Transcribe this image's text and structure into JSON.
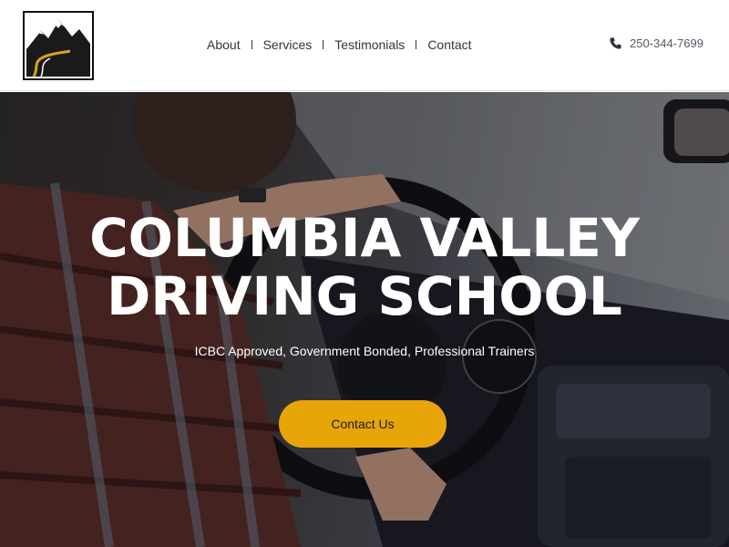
{
  "header": {
    "logo_alt": "mountain-road-logo",
    "nav": [
      {
        "label": "About"
      },
      {
        "label": "Services"
      },
      {
        "label": "Testimonials"
      },
      {
        "label": "Contact"
      }
    ],
    "phone": "250-344-7699",
    "phone_icon": "phone-icon"
  },
  "hero": {
    "title_line1": "COLUMBIA VALLEY",
    "title_line2": "DRIVING SCHOOL",
    "subtitle": "ICBC Approved, Government Bonded, Professional Trainers",
    "cta_label": "Contact Us",
    "cta_color": "#e8a50a"
  }
}
